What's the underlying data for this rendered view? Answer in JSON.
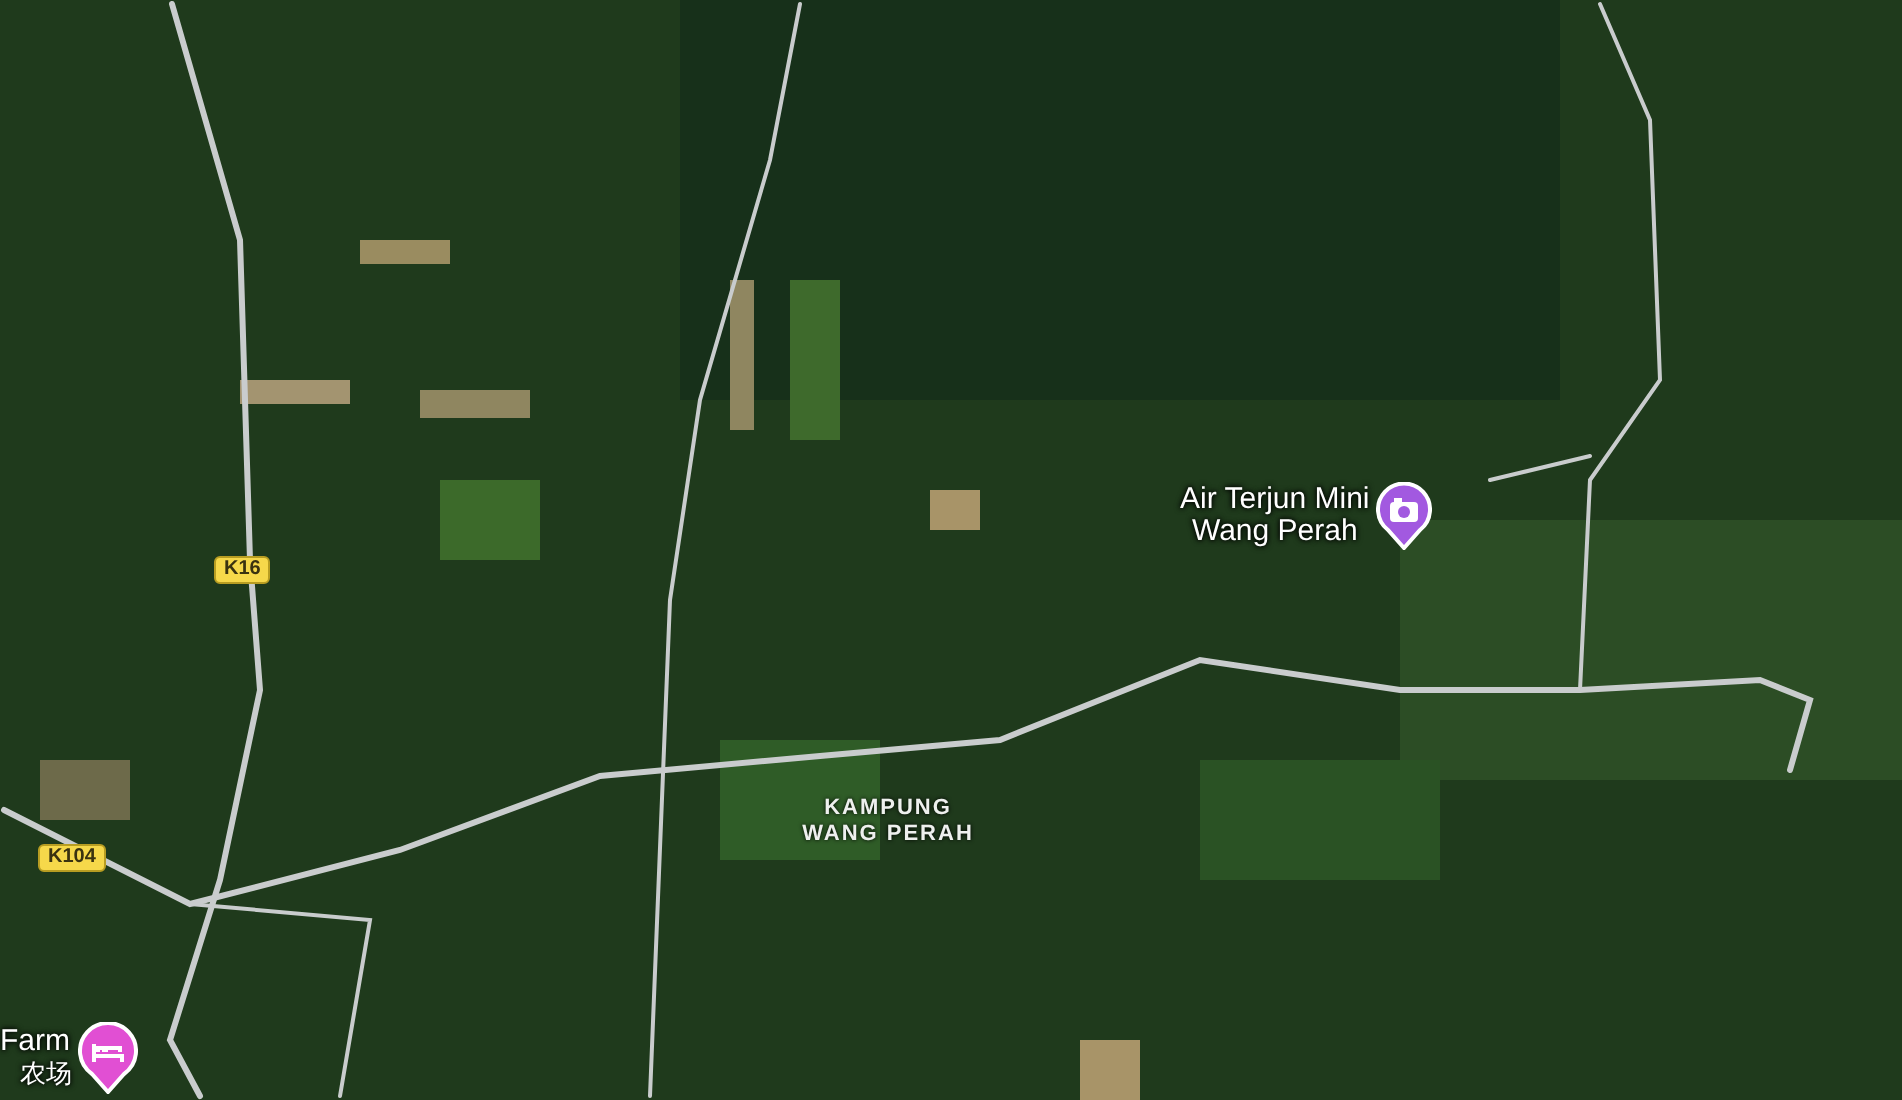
{
  "map": {
    "road_labels": [
      {
        "text": "K16"
      },
      {
        "text": "K104"
      }
    ],
    "area_labels": [
      {
        "lines": [
          "KAMPUNG",
          "WANG PERAH"
        ]
      }
    ],
    "places": [
      {
        "kind": "attraction",
        "lines": [
          "Air Terjun Mini",
          "Wang Perah"
        ]
      },
      {
        "kind": "lodging",
        "lines": [
          "Farm",
          "农场"
        ]
      }
    ]
  }
}
